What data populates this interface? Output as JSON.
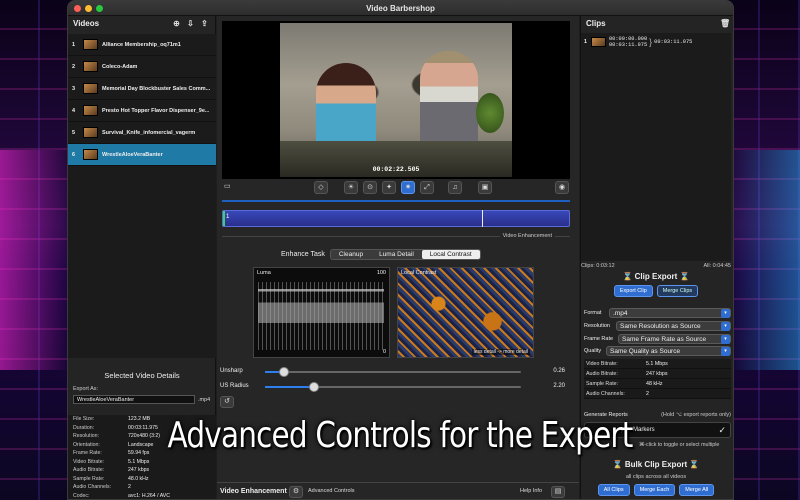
{
  "window": {
    "title": "Video Barbershop"
  },
  "videos": {
    "header": "Videos",
    "items": [
      {
        "num": "1",
        "name": "Alliance Membership_oq71m1"
      },
      {
        "num": "2",
        "name": "Coleco-Adam"
      },
      {
        "num": "3",
        "name": "Memorial Day Blockbuster Sales Comm..."
      },
      {
        "num": "4",
        "name": "Presto Hot Topper Flavor Dispenser_9e..."
      },
      {
        "num": "5",
        "name": "Survival_Knife_infomercial_vagerm"
      },
      {
        "num": "6",
        "name": "WrestleAloeVeraBanter"
      }
    ],
    "selected_index": 5
  },
  "details": {
    "title": "Selected Video Details",
    "export_as_label": "Export As:",
    "export_name": "WrestleAloeVeraBanter",
    "export_ext": ".mp4",
    "rows": [
      {
        "k": "File Size:",
        "v": "123.2 MB"
      },
      {
        "k": "Duration:",
        "v": "00:03:11.975"
      },
      {
        "k": "Resolution:",
        "v": "720x480 (3:2)"
      },
      {
        "k": "Orientation:",
        "v": "Landscape"
      },
      {
        "k": "Frame Rate:",
        "v": "59.94 fps"
      },
      {
        "k": "Video Bitrate:",
        "v": "5.1 Mbps"
      },
      {
        "k": "Audio Bitrate:",
        "v": "247 kbps"
      },
      {
        "k": "Sample Rate:",
        "v": "48.0 kHz"
      },
      {
        "k": "Audio Channels:",
        "v": "2"
      },
      {
        "k": "Codec:",
        "v": "avc1: H.264 / AVC"
      },
      {
        "k": "Alpha Channel:",
        "v": "No"
      }
    ]
  },
  "player": {
    "timecode": "00:02:22.505",
    "clip_number": "1",
    "section_label": "Video Enhancement"
  },
  "enhance": {
    "task_label": "Enhance Task",
    "tabs": [
      "Cleanup",
      "Luma Detail",
      "Local Contrast"
    ],
    "active_tab": "Local Contrast",
    "luma_scope": {
      "label": "Luma",
      "max": "100",
      "min": "0"
    },
    "lc_scope": {
      "label": "Local Contrast",
      "hint": "less detail -> more detail"
    },
    "unsharp": {
      "label": "Unsharp",
      "value": "0.26",
      "fraction": 0.075
    },
    "radius": {
      "label": "US Radius",
      "value": "2.20",
      "fraction": 0.19
    }
  },
  "footer": {
    "title": "Video Enhancement",
    "advanced_label": "Advanced Controls",
    "help_label": "Help Info"
  },
  "clips": {
    "header": "Clips",
    "items": [
      {
        "num": "1",
        "start": "00:00:00.000",
        "end": "00:03:11.975",
        "duration": "00:03:11.975"
      }
    ],
    "sum_left": "Clips: 0:03:12",
    "sum_right": "All: 0:04:45"
  },
  "clip_export": {
    "title": "Clip Export",
    "export_btn": "Export Clip",
    "merge_btn": "Merge Clips"
  },
  "format": {
    "format_label": "Format",
    "format_value": ".mp4",
    "resolution_label": "Resolution",
    "resolution_value": "Same Resolution as Source",
    "framerate_label": "Frame Rate",
    "framerate_value": "Same Frame Rate as Source",
    "quality_label": "Quality",
    "quality_value": "Same Quality as Source",
    "stats": [
      {
        "k": "Video Bitrate:",
        "v": "5.1 Mbps"
      },
      {
        "k": "Audio Bitrate:",
        "v": "247 kbps"
      },
      {
        "k": "Sample Rate:",
        "v": "48 kHz"
      },
      {
        "k": "Audio Channels:",
        "v": "2"
      }
    ]
  },
  "reports": {
    "label": "Generate Reports",
    "hint": "(Hold ⌥ export reports only)",
    "item": "pter Markers",
    "note": "⌘-click to toggle or select multiple"
  },
  "bulk": {
    "title": "Bulk Clip Export",
    "subtitle": "all clips across all videos",
    "all_clips": "All Clips",
    "merge_each": "Merge Each",
    "merge_all": "Merge All"
  },
  "caption": "Advanced Controls for the Expert",
  "colors": {
    "accent": "#2f6ed0",
    "selection": "#1f7aa6",
    "timeline": "#3848b8"
  }
}
